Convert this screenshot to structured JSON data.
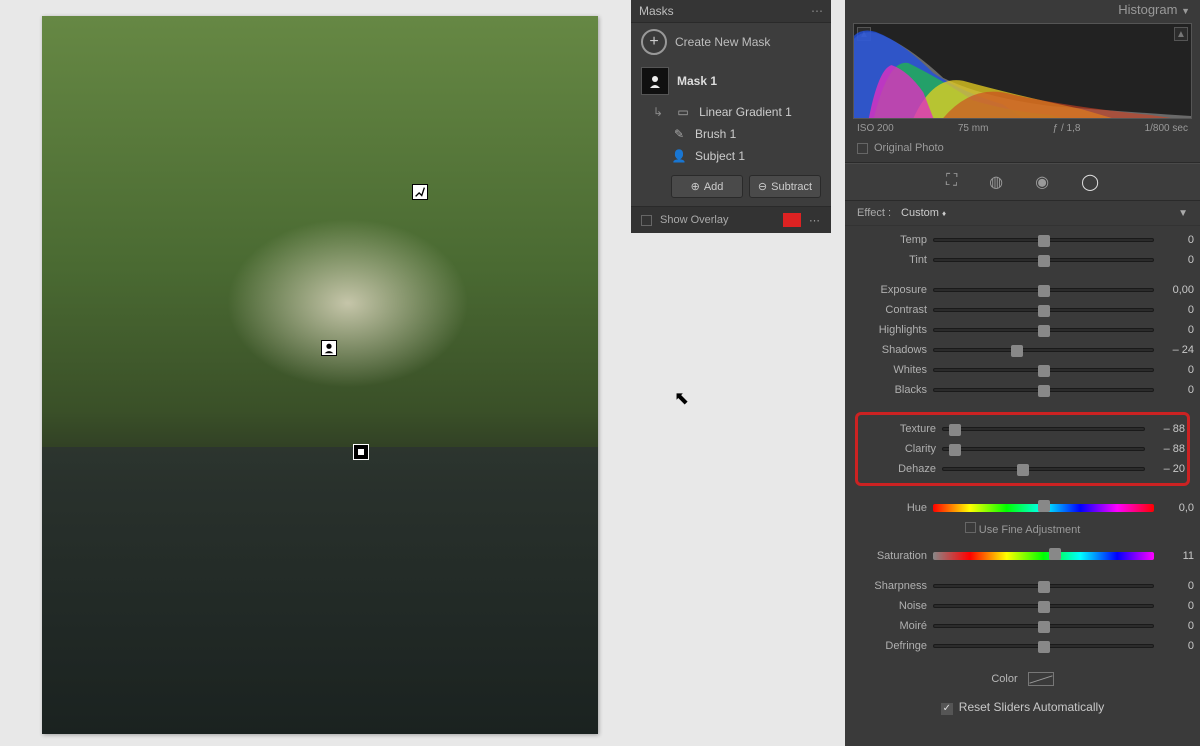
{
  "masks_panel": {
    "title": "Masks",
    "create_label": "Create New Mask",
    "mask1_label": "Mask 1",
    "items": [
      {
        "label": "Linear Gradient 1",
        "icon": "gradient"
      },
      {
        "label": "Brush 1",
        "icon": "brush"
      },
      {
        "label": "Subject 1",
        "icon": "subject"
      }
    ],
    "add_label": "Add",
    "subtract_label": "Subtract",
    "overlay_label": "Show Overlay"
  },
  "histogram": {
    "title": "Histogram",
    "iso": "ISO 200",
    "focal": "75 mm",
    "aperture": "ƒ / 1,8",
    "shutter": "1/800 sec",
    "original_label": "Original Photo"
  },
  "effect": {
    "label": "Effect :",
    "preset": "Custom"
  },
  "sliders": {
    "temp": {
      "label": "Temp",
      "value": "0",
      "pos": 50
    },
    "tint": {
      "label": "Tint",
      "value": "0",
      "pos": 50
    },
    "exposure": {
      "label": "Exposure",
      "value": "0,00",
      "pos": 50
    },
    "contrast": {
      "label": "Contrast",
      "value": "0",
      "pos": 50
    },
    "highlights": {
      "label": "Highlights",
      "value": "0",
      "pos": 50
    },
    "shadows": {
      "label": "Shadows",
      "value": "– 24",
      "pos": 38
    },
    "whites": {
      "label": "Whites",
      "value": "0",
      "pos": 50
    },
    "blacks": {
      "label": "Blacks",
      "value": "0",
      "pos": 50
    },
    "texture": {
      "label": "Texture",
      "value": "– 88",
      "pos": 6
    },
    "clarity": {
      "label": "Clarity",
      "value": "– 88",
      "pos": 6
    },
    "dehaze": {
      "label": "Dehaze",
      "value": "– 20",
      "pos": 40
    },
    "hue": {
      "label": "Hue",
      "value": "0,0",
      "pos": 50
    },
    "saturation": {
      "label": "Saturation",
      "value": "11",
      "pos": 55
    },
    "sharpness": {
      "label": "Sharpness",
      "value": "0",
      "pos": 50
    },
    "noise": {
      "label": "Noise",
      "value": "0",
      "pos": 50
    },
    "moire": {
      "label": "Moiré",
      "value": "0",
      "pos": 50
    },
    "defringe": {
      "label": "Defringe",
      "value": "0",
      "pos": 50
    }
  },
  "fine_label": "Use Fine Adjustment",
  "color_label": "Color",
  "reset_label": "Reset Sliders Automatically"
}
